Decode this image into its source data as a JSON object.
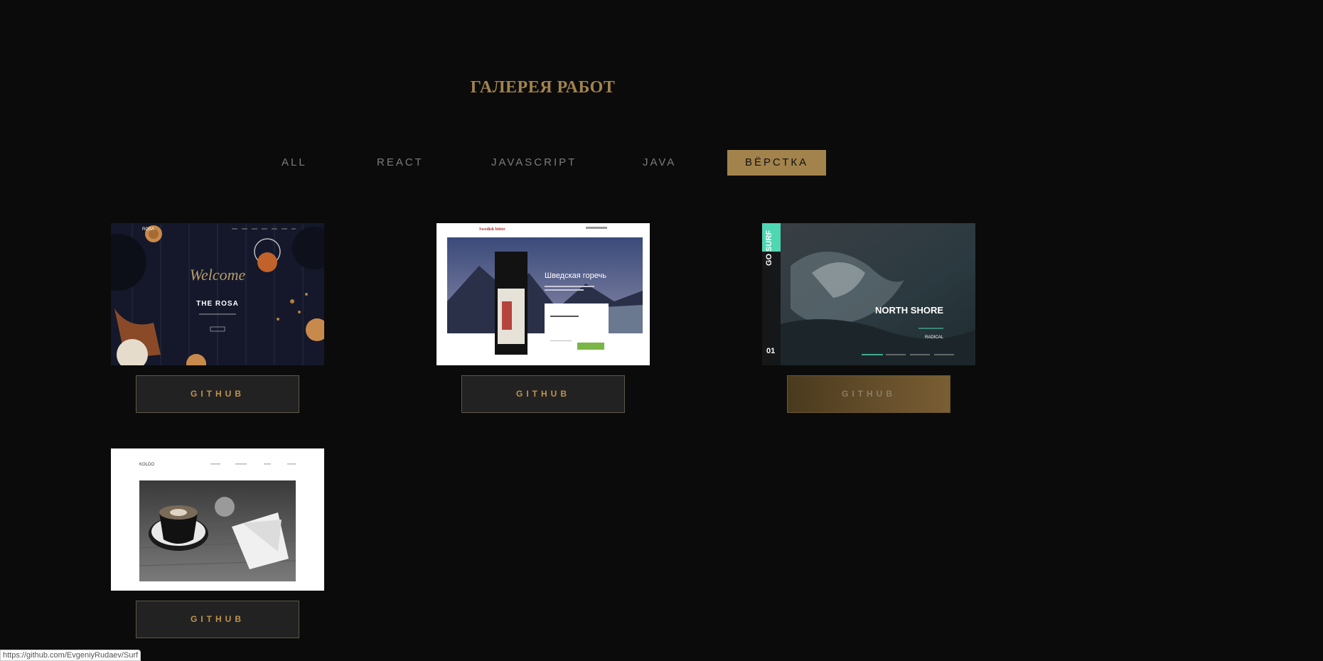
{
  "gallery": {
    "title": "ГАЛЕРЕЯ РАБОТ"
  },
  "filters": {
    "items": [
      {
        "label": "ALL"
      },
      {
        "label": "REACT"
      },
      {
        "label": "JAVASCRIPT"
      },
      {
        "label": "JAVA"
      },
      {
        "label": "ВЁРСТКА",
        "active": true
      }
    ]
  },
  "projects": [
    {
      "name": "The Rosa",
      "welcome": "Welcome",
      "heading": "THE ROSA",
      "logo": "ROSA",
      "button": "GITHUB"
    },
    {
      "name": "Swedish Bitter",
      "heading": "Шведская горечь",
      "logo": "Swedish bitter",
      "button": "GITHUB"
    },
    {
      "name": "Surf",
      "heading": "NORTH SHORE",
      "badge": "GO SURF",
      "sub": "RADICAL",
      "counter": "01",
      "button": "GITHUB",
      "hover": true
    },
    {
      "name": "Coffee",
      "logo": "KOLDO",
      "button": "GITHUB"
    }
  ],
  "status_bar": {
    "url": "https://github.com/EvgeniyRudaev/Surf"
  },
  "colors": {
    "accent": "#a3834c",
    "background": "#0b0b0b",
    "button_text": "#c0934d"
  }
}
